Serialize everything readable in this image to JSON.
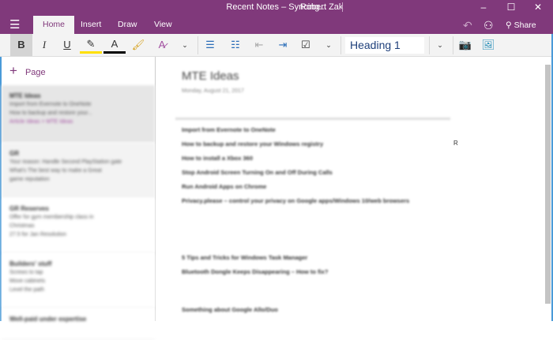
{
  "window": {
    "title": "Recent Notes – Syncing...",
    "user": "Robert Zak",
    "minimize": "–",
    "maximize": "☐",
    "close": "✕"
  },
  "ribbon": {
    "tabs": [
      "Home",
      "Insert",
      "Draw",
      "View"
    ],
    "share_label": "Share"
  },
  "toolbar": {
    "bold": "B",
    "italic": "I",
    "underline": "U",
    "font_color": "A",
    "style_value": "Heading 1"
  },
  "pages": {
    "add_label": "Page",
    "items": [
      {
        "title": "MTE Ideas",
        "lines": [
          "Import from Evernote to OneNote",
          "How to backup and restore your..."
        ],
        "meta": "Article Ideas > MTE Ideas"
      },
      {
        "title": "GR",
        "lines": [
          "Your reason: Handle Second PlayStation gate",
          "What's The best way to make a Great",
          "game reputation"
        ]
      },
      {
        "title": "GR Reserves",
        "lines": [
          "Offer for gym membership class in",
          "Christmas",
          "27.5 for Jan Resolution"
        ]
      },
      {
        "title": "Builders' stuff",
        "lines": [
          "Screws to tap",
          "Move cabinets",
          "Level the path"
        ]
      },
      {
        "title": "Well-paid under expertise",
        "lines": []
      }
    ]
  },
  "note": {
    "title": "MTE Ideas",
    "date": "Monday, August 21, 2017",
    "lines": [
      "Import from Evernote to OneNote",
      "How to backup and restore your Windows registry",
      "How to install a Xbox 360",
      "Stop Android Screen Turning On and Off During Calls",
      "Run Android Apps on Chrome",
      "Privacy.please – control your privacy on Google apps/Windows 10/web browsers",
      "5 Tips and Tricks for Windows Task Manager",
      "Bluetooth Dongle Keeps Disappearing – How to fix?",
      "Something about Google Allo/Duo"
    ],
    "cursor_label": "R"
  },
  "colors": {
    "accent": "#80397b",
    "edge": "#4a9ad8"
  }
}
